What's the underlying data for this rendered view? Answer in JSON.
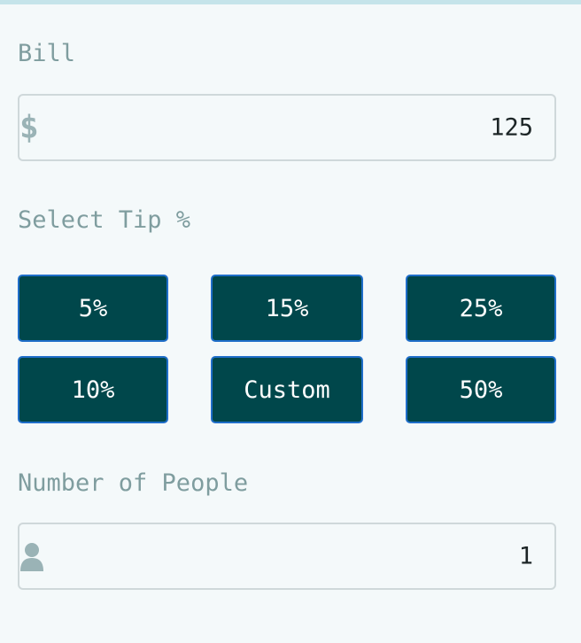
{
  "bill": {
    "label": "Bill",
    "currency_symbol": "$",
    "value": "125"
  },
  "tip": {
    "label": "Select Tip %",
    "options": [
      "5%",
      "15%",
      "25%",
      "10%",
      "Custom",
      "50%"
    ]
  },
  "people": {
    "label": "Number of People",
    "icon": "person-icon",
    "value": "1"
  },
  "colors": {
    "background": "#f4f9fa",
    "button": "#00474b",
    "button_border": "#1f6ec9",
    "label": "#7f9d9f"
  }
}
